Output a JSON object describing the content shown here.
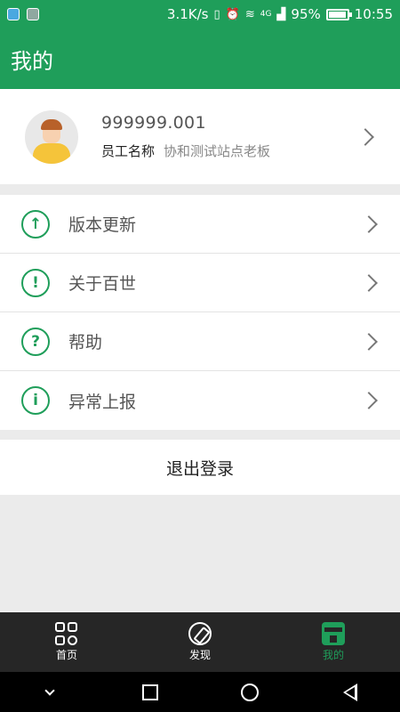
{
  "status_bar": {
    "network_speed": "3.1K/s",
    "network_type": "4G",
    "battery_percent": "95%",
    "battery_level": 0.95,
    "time": "10:55"
  },
  "app_bar": {
    "title": "我的"
  },
  "profile": {
    "user_id": "999999.001",
    "role_label": "员工名称",
    "station_name": "协和测试站点老板"
  },
  "menu": [
    {
      "label": "版本更新",
      "icon": "↑"
    },
    {
      "label": "关于百世",
      "icon": "!"
    },
    {
      "label": "帮助",
      "icon": "?"
    },
    {
      "label": "异常上报",
      "icon": "i"
    }
  ],
  "logout_label": "退出登录",
  "bottom_nav": {
    "home": "首页",
    "discover": "发现",
    "mine": "我的"
  },
  "colors": {
    "accent": "#1f9e5a",
    "nav_background": "#262626"
  }
}
